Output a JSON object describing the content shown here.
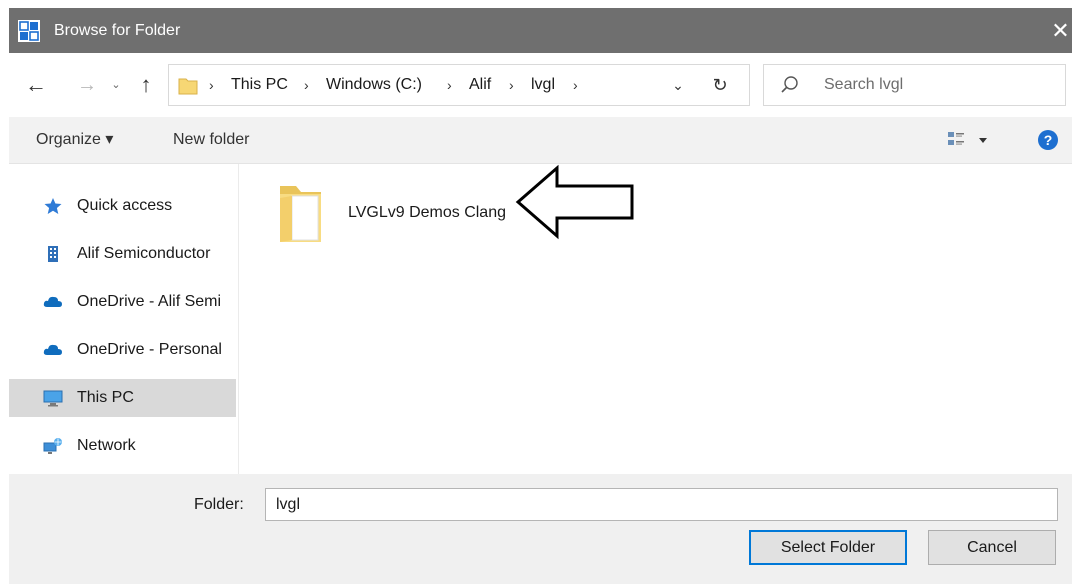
{
  "window": {
    "title": "Browse for Folder",
    "close_glyph": "✕"
  },
  "nav": {
    "back_glyph": "←",
    "forward_glyph": "→",
    "recent_glyph": "⌄",
    "up_glyph": "↑",
    "breadcrumb": [
      "This PC",
      "Windows (C:)",
      "Alif",
      "lvgl"
    ],
    "separator_glyph": "›",
    "dropdown_glyph": "⌄",
    "refresh_glyph": "↻"
  },
  "search": {
    "placeholder": "Search lvgl"
  },
  "toolbar": {
    "organize_label": "Organize ▾",
    "new_folder_label": "New folder"
  },
  "sidebar": {
    "items": [
      {
        "label": "Quick access",
        "icon": "star-icon"
      },
      {
        "label": "Alif Semiconductor",
        "icon": "building-icon"
      },
      {
        "label": "OneDrive - Alif Semi",
        "icon": "cloud-icon"
      },
      {
        "label": "OneDrive - Personal",
        "icon": "cloud-icon"
      },
      {
        "label": "This PC",
        "icon": "computer-icon",
        "selected": true
      },
      {
        "label": "Network",
        "icon": "network-icon"
      }
    ]
  },
  "content": {
    "items": [
      {
        "name": "LVGLv9 Demos Clang",
        "icon": "folder-icon"
      }
    ]
  },
  "footer": {
    "folder_label": "Folder:",
    "folder_value": "lvgl",
    "select_button": "Select Folder",
    "cancel_button": "Cancel"
  },
  "colors": {
    "titlebar": "#6f6f6f",
    "selection": "#d9d9d9",
    "accent": "#0078d7",
    "folder": "#f7d774",
    "onedrive": "#0f6cbd"
  }
}
